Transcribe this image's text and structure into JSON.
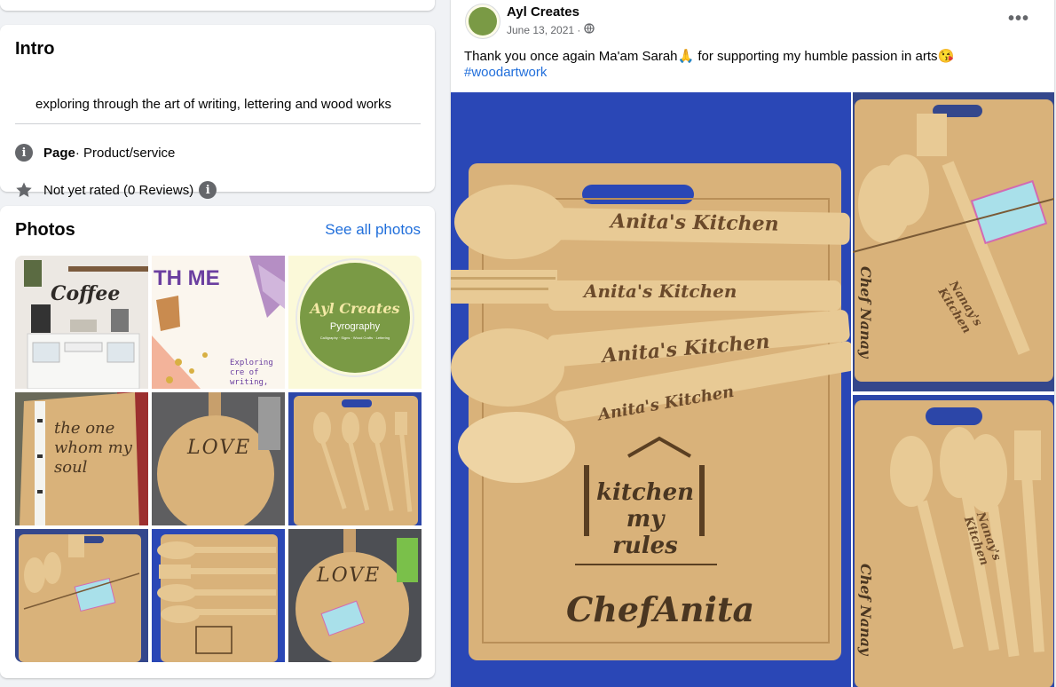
{
  "intro": {
    "title": "Intro",
    "bio": "exploring through the art of writing, lettering and wood works",
    "page_label": "Page",
    "page_category": " · Product/service",
    "rating_text": "Not yet rated (0 Reviews)",
    "info_icon_glyph": "i"
  },
  "photos": {
    "title": "Photos",
    "see_all": "See all photos",
    "thumbs": [
      {
        "icon": "coffee-shelf-photo",
        "text": "Coffee"
      },
      {
        "icon": "fabric-tag-photo",
        "text": "TH ME",
        "caption": "Exploring cre of writing,"
      },
      {
        "icon": "logo-photo",
        "text": "Ayl Creates",
        "sub": "Pyrography",
        "line": "Calligraphy · Signs · Wood Crafts · Lettering"
      },
      {
        "icon": "birch-board-photo",
        "text": "the one whom my soul"
      },
      {
        "icon": "love-board-photo",
        "text": "LOVE"
      },
      {
        "icon": "spoons-board-photo",
        "text": ""
      },
      {
        "icon": "spoons-gift-photo",
        "text": ""
      },
      {
        "icon": "spoons-set-photo",
        "text": ""
      },
      {
        "icon": "love-gift-photo",
        "text": "LOVE"
      }
    ]
  },
  "post": {
    "author": "Ayl Creates",
    "date": "June 13, 2021 ·",
    "text": "Thank you once again Ma'am Sarah🙏 for supporting my humble passion in arts😘",
    "hashtag": "#woodartwork",
    "more_glyph": "•••",
    "images": {
      "main": {
        "label": "Anita's Kitchen",
        "stamp": "kitchen my rules",
        "name": "ChefAnita"
      },
      "right_top": {
        "label": "Nanay's Kitchen",
        "name": "Chef Nanay"
      },
      "right_bottom": {
        "label": "Nanay's Kitchen",
        "name": "Chef Nanay"
      }
    }
  },
  "colors": {
    "link": "#216fdb",
    "background": "#f0f2f5",
    "secondary_text": "#65676b",
    "wood": "#d9b27a",
    "cloth_blue": "#2a47b6"
  }
}
